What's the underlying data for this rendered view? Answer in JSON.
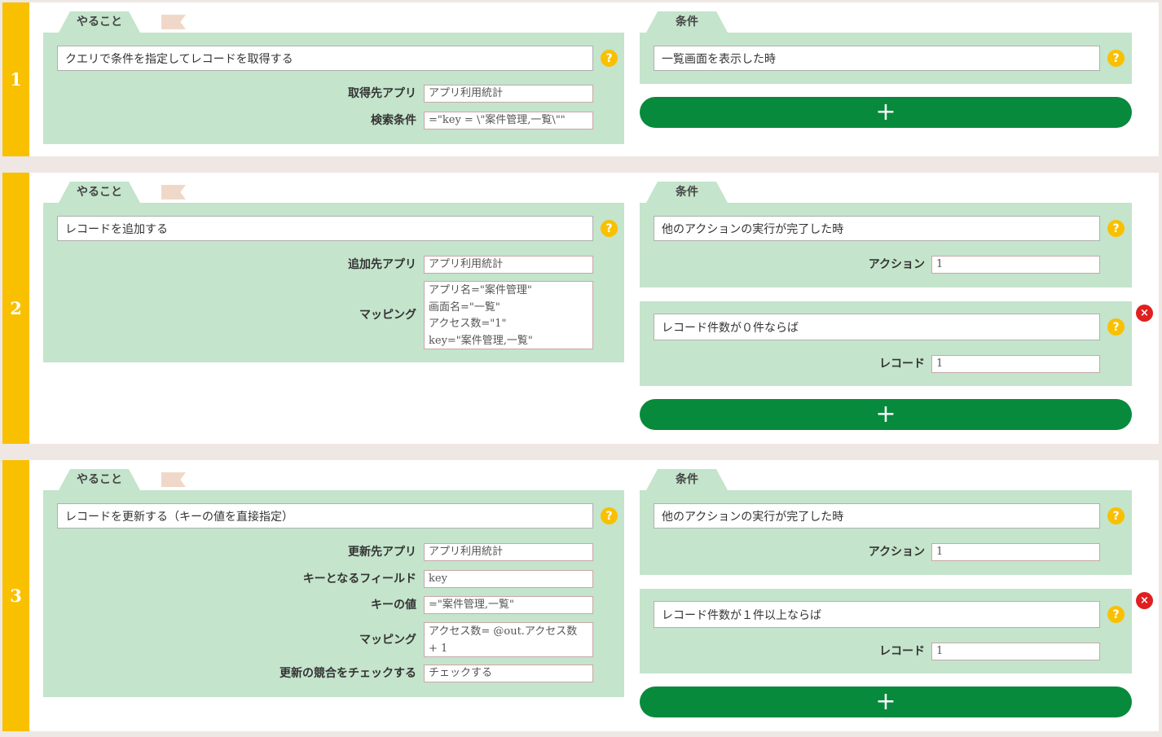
{
  "help_icon": "?",
  "plus_icon": "+",
  "delete_icon": "×",
  "rows": [
    {
      "number": "1",
      "action": {
        "tab": "やること",
        "title": "クエリで条件を指定してレコードを取得する",
        "params": [
          {
            "label": "取得先アプリ",
            "value": "アプリ利用統計"
          },
          {
            "label": "検索条件",
            "value": "=\"key = \\\"案件管理,一覧\\\"\""
          }
        ]
      },
      "conditions": [
        {
          "tab": "条件",
          "title": "一覧画面を表示した時",
          "params": []
        }
      ]
    },
    {
      "number": "2",
      "action": {
        "tab": "やること",
        "title": "レコードを追加する",
        "params": [
          {
            "label": "追加先アプリ",
            "value": "アプリ利用統計"
          },
          {
            "label": "マッピング",
            "value": "アプリ名=\"案件管理\"\n画面名=\"一覧\"\nアクセス数=\"1\"\nkey=\"案件管理,一覧\""
          }
        ]
      },
      "conditions": [
        {
          "tab": "条件",
          "title": "他のアクションの実行が完了した時",
          "params": [
            {
              "label": "アクション",
              "value": "1"
            }
          ]
        },
        {
          "title": "レコード件数が０件ならば",
          "params": [
            {
              "label": "レコード",
              "value": "1"
            }
          ]
        }
      ]
    },
    {
      "number": "3",
      "action": {
        "tab": "やること",
        "title": "レコードを更新する（キーの値を直接指定）",
        "params": [
          {
            "label": "更新先アプリ",
            "value": "アプリ利用統計"
          },
          {
            "label": "キーとなるフィールド",
            "value": "key"
          },
          {
            "label": "キーの値",
            "value": "=\"案件管理,一覧\""
          },
          {
            "label": "マッピング",
            "value": "アクセス数= @out.アクセス数 + 1"
          },
          {
            "label": "更新の競合をチェックする",
            "value": "チェックする"
          }
        ]
      },
      "conditions": [
        {
          "tab": "条件",
          "title": "他のアクションの実行が完了した時",
          "params": [
            {
              "label": "アクション",
              "value": "1"
            }
          ]
        },
        {
          "title": "レコード件数が１件以上ならば",
          "params": [
            {
              "label": "レコード",
              "value": "1"
            }
          ]
        }
      ]
    }
  ]
}
